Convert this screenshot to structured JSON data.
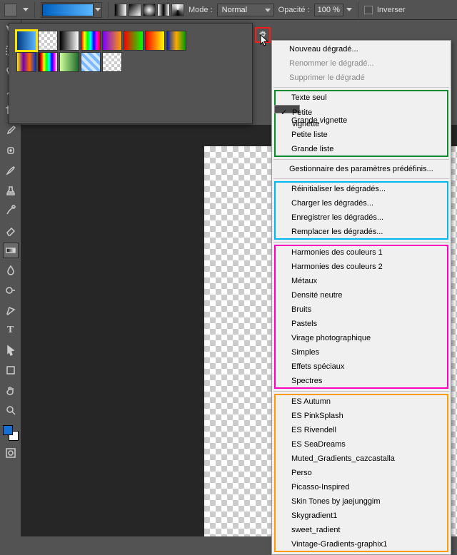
{
  "toolbar": {
    "mode_label": "Mode :",
    "mode_value": "Normal",
    "opacity_label": "Opacité :",
    "opacity_value": "100 %",
    "invert_label": "Inverser"
  },
  "picker": {
    "swatches": [
      {
        "css": "linear-gradient(90deg,#003a82,#5db7ff)",
        "sel": true
      },
      {
        "css": "repeating-conic-gradient(#ccc 0 25%,#fff 0 50%)",
        "sel": false
      },
      {
        "css": "linear-gradient(90deg,#000,#fff)",
        "sel": false
      },
      {
        "css": "linear-gradient(90deg,#ff0000,#ffff00,#00ff00,#00ffff,#0000ff,#ff00ff,#ff0000)",
        "sel": false
      },
      {
        "css": "linear-gradient(90deg,#7a00ff,#ff9a00)",
        "sel": false
      },
      {
        "css": "linear-gradient(90deg,#ff0000,#00ff00)",
        "sel": false
      },
      {
        "css": "linear-gradient(90deg,#ff0000,#ffff00)",
        "sel": false
      },
      {
        "css": "linear-gradient(90deg,#0022aa,#ffaa00,#009900)",
        "sel": false
      },
      {
        "css": "linear-gradient(90deg,#ffee00,#7000b0,#ff6a00,#0033cc)",
        "sel": false
      },
      {
        "css": "linear-gradient(90deg,#000,#ff0000,#ffff00,#00ff00,#00ffff,#0000ff,#ff00ff,#fff)",
        "sel": false
      },
      {
        "css": "linear-gradient(90deg,#d0ff9a,#1e6b2d)",
        "sel": false
      },
      {
        "css": "repeating-linear-gradient(45deg,#7bb8ff 0 4px,#cfe7ff 4px 8px)",
        "sel": false
      },
      {
        "css": "repeating-conic-gradient(#ccc 0 25%,#fff 0 50%)",
        "sel": false
      }
    ]
  },
  "menu": {
    "group1": [
      {
        "label": "Nouveau dégradé..."
      },
      {
        "label": "Renommer le dégradé...",
        "disabled": true
      },
      {
        "label": "Supprimer le dégradé",
        "disabled": true
      }
    ],
    "group_view": {
      "color": "#0a8a2a",
      "items": [
        {
          "label": "Texte seul"
        },
        {
          "label": "Petite vignette",
          "checked": true
        },
        {
          "label": "Grande vignette"
        },
        {
          "label": "Petite liste"
        },
        {
          "label": "Grande liste"
        }
      ]
    },
    "presets_mgr": {
      "label": "Gestionnaire des paramètres prédéfinis..."
    },
    "group_io": {
      "color": "#00b6ef",
      "items": [
        {
          "label": "Réinitialiser les dégradés..."
        },
        {
          "label": "Charger les dégradés..."
        },
        {
          "label": "Enregistrer les dégradés..."
        },
        {
          "label": "Remplacer les dégradés..."
        }
      ]
    },
    "group_sets": {
      "color": "#ff00c0",
      "items": [
        {
          "label": "Harmonies des couleurs 1"
        },
        {
          "label": "Harmonies des couleurs 2"
        },
        {
          "label": "Métaux"
        },
        {
          "label": "Densité neutre"
        },
        {
          "label": "Bruits"
        },
        {
          "label": "Pastels"
        },
        {
          "label": "Virage photographique"
        },
        {
          "label": "Simples"
        },
        {
          "label": "Effets spéciaux"
        },
        {
          "label": "Spectres"
        }
      ]
    },
    "group_user": {
      "color": "#ff9a00",
      "items": [
        {
          "label": "ES Autumn"
        },
        {
          "label": "ES PinkSplash"
        },
        {
          "label": "ES Rivendell"
        },
        {
          "label": "ES SeaDreams"
        },
        {
          "label": "Muted_Gradients_cazcastalla"
        },
        {
          "label": "Perso"
        },
        {
          "label": "Picasso-Inspired"
        },
        {
          "label": "Skin Tones by jaejunggim"
        },
        {
          "label": "Skygradient1"
        },
        {
          "label": "sweet_radient"
        },
        {
          "label": "Vintage-Gradients-graphix1"
        }
      ]
    }
  }
}
